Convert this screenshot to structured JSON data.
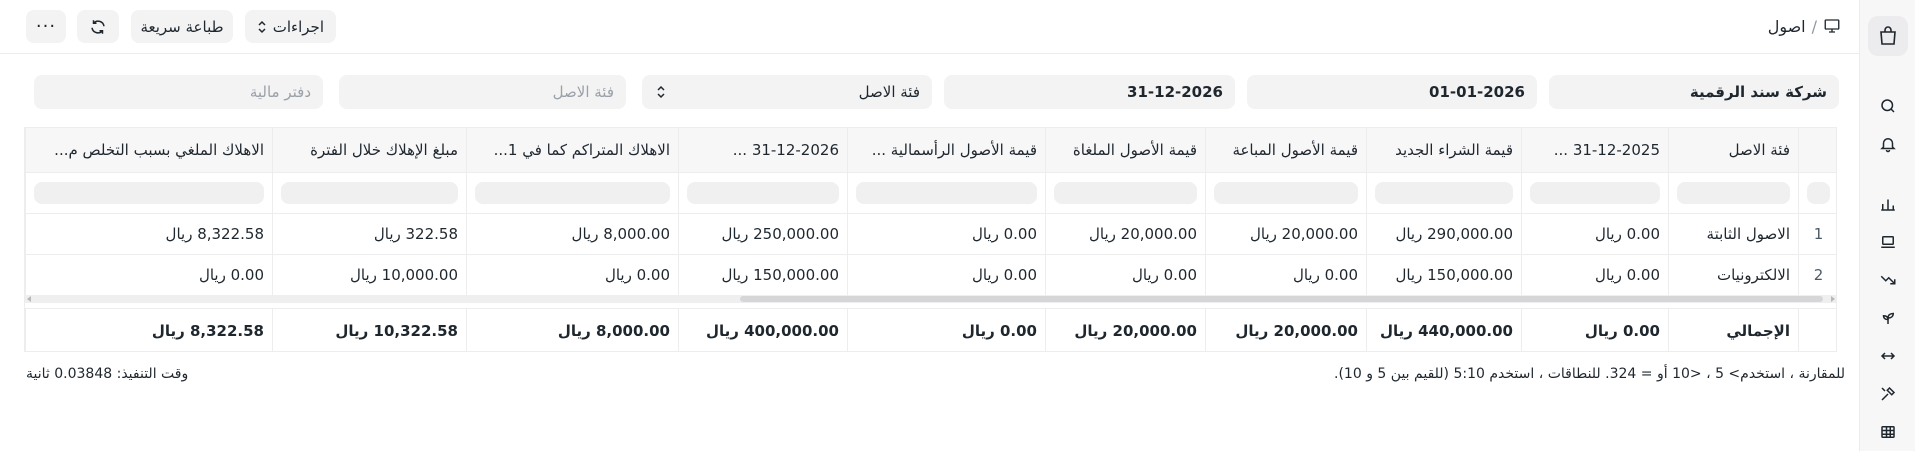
{
  "breadcrumb": {
    "section": "اصول"
  },
  "toolbar": {
    "actions_label": "اجراءات",
    "quick_print_label": "طباعة سريعة"
  },
  "filters": {
    "company": "شركة سند الرقمية",
    "from_date": "01-01-2026",
    "to_date": "31-12-2026",
    "asset_category_select": "فئة الاصل",
    "asset_category_placeholder": "فئة الاصل",
    "finance_book_placeholder": "دفتر مالية"
  },
  "table": {
    "columns": [
      "فئة الاصل",
      "31-12-2025 ...",
      "قيمة الشراء الجديد",
      "قيمة الأصول المباعة",
      "قيمة الأصول الملغاة",
      "قيمة الأصول الرأسمالية ...",
      "31-12-2026 ...",
      "الاهلاك المتراكم كما في 1...",
      "مبلغ الإهلاك خلال الفترة",
      "الاهلاك الملغي بسبب التخلص م..."
    ],
    "rows": [
      {
        "index": "1",
        "cells": [
          "الاصول الثابتة",
          "0.00 ريال",
          "290,000.00 ريال",
          "20,000.00 ريال",
          "20,000.00 ريال",
          "0.00 ريال",
          "250,000.00 ريال",
          "8,000.00 ريال",
          "322.58 ريال",
          "8,322.58 ريال"
        ]
      },
      {
        "index": "2",
        "cells": [
          "الالكترونيات",
          "0.00 ريال",
          "150,000.00 ريال",
          "0.00 ريال",
          "0.00 ريال",
          "0.00 ريال",
          "150,000.00 ريال",
          "0.00 ريال",
          "10,000.00 ريال",
          "0.00 ريال"
        ]
      }
    ],
    "total": [
      "الإجمالي",
      "0.00 ريال",
      "440,000.00 ريال",
      "20,000.00 ريال",
      "20,000.00 ريال",
      "0.00 ريال",
      "400,000.00 ريال",
      "8,000.00 ريال",
      "10,322.58 ريال",
      "8,322.58 ريال"
    ]
  },
  "footer": {
    "hint": "للمقارنة ، استخدم> 5 ، <10 أو = 324. للنطاقات ، استخدم 5:10 (للقيم بين 5 و 10).",
    "exec_time": "وقت التنفيذ: 0.03848 ثانية"
  },
  "icons": {
    "sidebar": [
      "app-logo-icon",
      "search-icon",
      "bell-icon",
      "chart-icon",
      "laptop-icon",
      "trend-down-icon",
      "plant-icon",
      "arrows-horizontal-icon",
      "tools-icon",
      "table-icon"
    ]
  }
}
